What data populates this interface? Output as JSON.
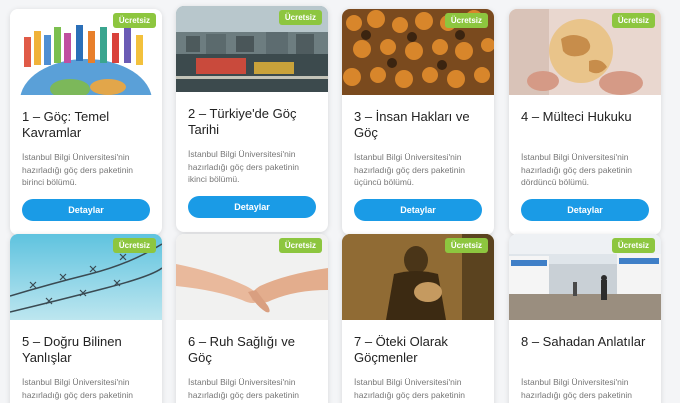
{
  "badge_label": "Ücretsiz",
  "button_label": "Detaylar",
  "cards": [
    {
      "title": "1 – Göç: Temel Kavramlar",
      "desc": "İstanbul Bilgi Üniversitesi'nin hazırladığı göç ders paketinin birinci bölümü."
    },
    {
      "title": "2 – Türkiye'de Göç Tarihi",
      "desc": "İstanbul Bilgi Üniversitesi'nin hazırladığı göç ders paketinin ikinci bölümü."
    },
    {
      "title": "3 – İnsan Hakları ve Göç",
      "desc": "İstanbul Bilgi Üniversitesi'nin hazırladığı göç ders paketinin üçüncü bölümü."
    },
    {
      "title": "4 – Mülteci Hukuku",
      "desc": "İstanbul Bilgi Üniversitesi'nin hazırladığı göç ders paketinin dördüncü bölümü."
    },
    {
      "title": "5 – Doğru Bilinen Yanlışlar",
      "desc": "İstanbul Bilgi Üniversitesi'nin hazırladığı göç ders paketinin beşinci bölümü."
    },
    {
      "title": "6 – Ruh Sağlığı ve Göç",
      "desc": "İstanbul Bilgi Üniversitesi'nin hazırladığı göç ders paketinin altıncı bölümü."
    },
    {
      "title": "7 – Öteki Olarak Göçmenler",
      "desc": "İstanbul Bilgi Üniversitesi'nin hazırladığı göç ders paketinin yedinci bölümü."
    },
    {
      "title": "8 – Sahadan Anlatılar",
      "desc": "İstanbul Bilgi Üniversitesi'nin hazırladığı göç ders paketinin sekizinci bölümü."
    }
  ],
  "colors": {
    "badge": "#8dc63f",
    "button": "#1a9be6"
  }
}
